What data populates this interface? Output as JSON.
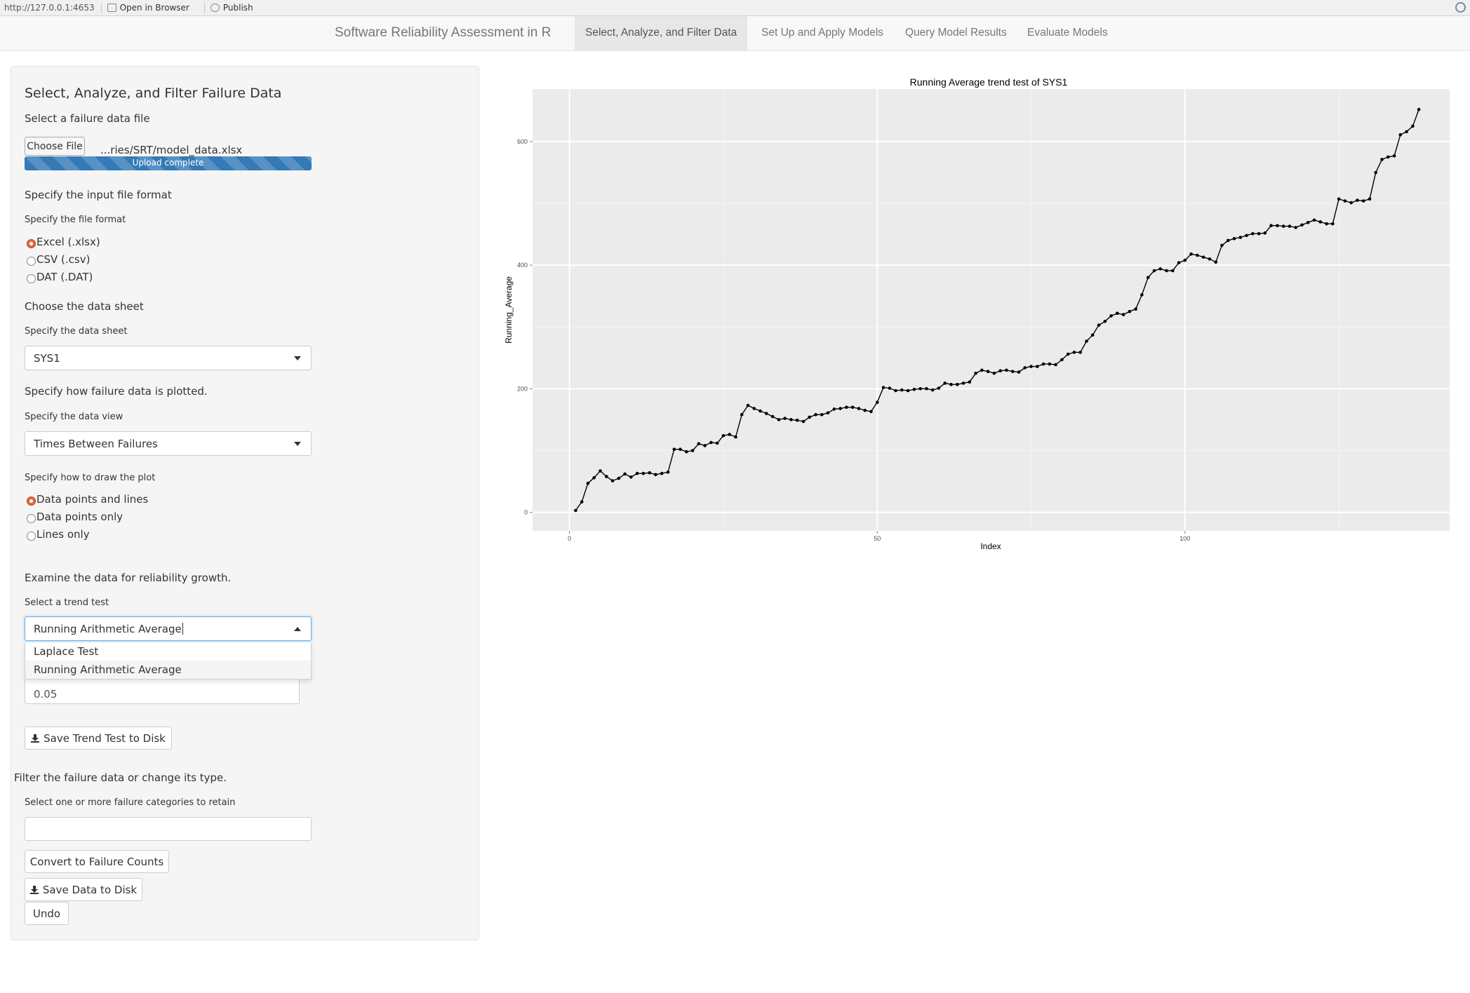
{
  "topbar": {
    "url": "http://127.0.0.1:4653",
    "open_browser": "Open in Browser",
    "publish": "Publish"
  },
  "navbar": {
    "brand": "Software Reliability Assessment in R",
    "tabs": [
      "Select, Analyze, and Filter Data",
      "Set Up and Apply Models",
      "Query Model Results",
      "Evaluate Models"
    ],
    "active_tab": 0
  },
  "sidebar": {
    "title": "Select, Analyze, and Filter Failure Data",
    "file_label": "Select a failure data file",
    "choose_file": "Choose File",
    "file_name": "...ries/SRT/model_data.xlsx",
    "upload_status": "Upload complete",
    "upload_progress": 1.0,
    "format_heading": "Specify the input file format",
    "format_label": "Specify the file format",
    "format_options": [
      "Excel (.xlsx)",
      "CSV (.csv)",
      "DAT (.DAT)"
    ],
    "format_selected": 0,
    "sheet_heading": "Choose the data sheet",
    "sheet_label": "Specify the data sheet",
    "sheet_value": "SYS1",
    "plot_heading": "Specify how failure data is plotted.",
    "view_label": "Specify the data view",
    "view_value": "Times Between Failures",
    "draw_label": "Specify how to draw the plot",
    "draw_options": [
      "Data points and lines",
      "Data points only",
      "Lines only"
    ],
    "draw_selected": 0,
    "trend_heading": "Examine the data for reliability growth.",
    "trend_label": "Select a trend test",
    "trend_value": "Running Arithmetic Average",
    "trend_options": [
      "Laplace Test",
      "Running Arithmetic Average"
    ],
    "confidence_value": "0.05",
    "save_trend": "Save Trend Test to Disk",
    "filter_heading": "Filter the failure data or change its type.",
    "categories_label": "Select one or more failure categories to retain",
    "convert_button": "Convert to Failure Counts",
    "save_data": "Save Data to Disk",
    "undo": "Undo"
  },
  "colors": {
    "panel_bg": "#ebebeb",
    "accent_radio": "#e5693f",
    "progress": "#337ab7"
  },
  "chart_data": {
    "type": "line",
    "title": "Running Average trend test of  SYS1",
    "xlabel": "Index",
    "ylabel": "Running_Average",
    "xlim": [
      -6,
      143
    ],
    "ylim": [
      -30,
      685
    ],
    "xticks": [
      0,
      50,
      100
    ],
    "yticks": [
      0,
      200,
      400,
      600
    ],
    "grid": true,
    "markers": true,
    "series": [
      {
        "values": [
          3,
          17,
          47,
          56,
          67,
          58,
          51,
          55,
          62,
          57,
          63,
          63,
          64,
          61,
          63,
          65,
          102,
          102,
          98,
          100,
          111,
          108,
          113,
          112,
          124,
          126,
          122,
          158,
          173,
          168,
          164,
          160,
          155,
          150,
          152,
          150,
          149,
          147,
          154,
          158,
          158,
          161,
          167,
          168,
          170,
          170,
          168,
          165,
          163,
          178,
          202,
          201,
          197,
          198,
          197,
          199,
          200,
          200,
          198,
          201,
          209,
          207,
          207,
          209,
          211,
          225,
          230,
          228,
          225,
          229,
          230,
          228,
          227,
          234,
          236,
          236,
          240,
          240,
          239,
          247,
          256,
          259,
          259,
          277,
          287,
          303,
          309,
          318,
          322,
          320,
          325,
          329,
          352,
          380,
          391,
          394,
          391,
          391,
          404,
          408,
          418,
          416,
          413,
          410,
          405,
          432,
          440,
          443,
          445,
          448,
          451,
          451,
          452,
          464,
          464,
          463,
          463,
          461,
          465,
          469,
          473,
          470,
          467,
          467,
          507,
          504,
          501,
          505,
          504,
          507,
          550,
          571,
          575,
          577,
          611,
          616,
          625,
          652
        ]
      }
    ]
  }
}
